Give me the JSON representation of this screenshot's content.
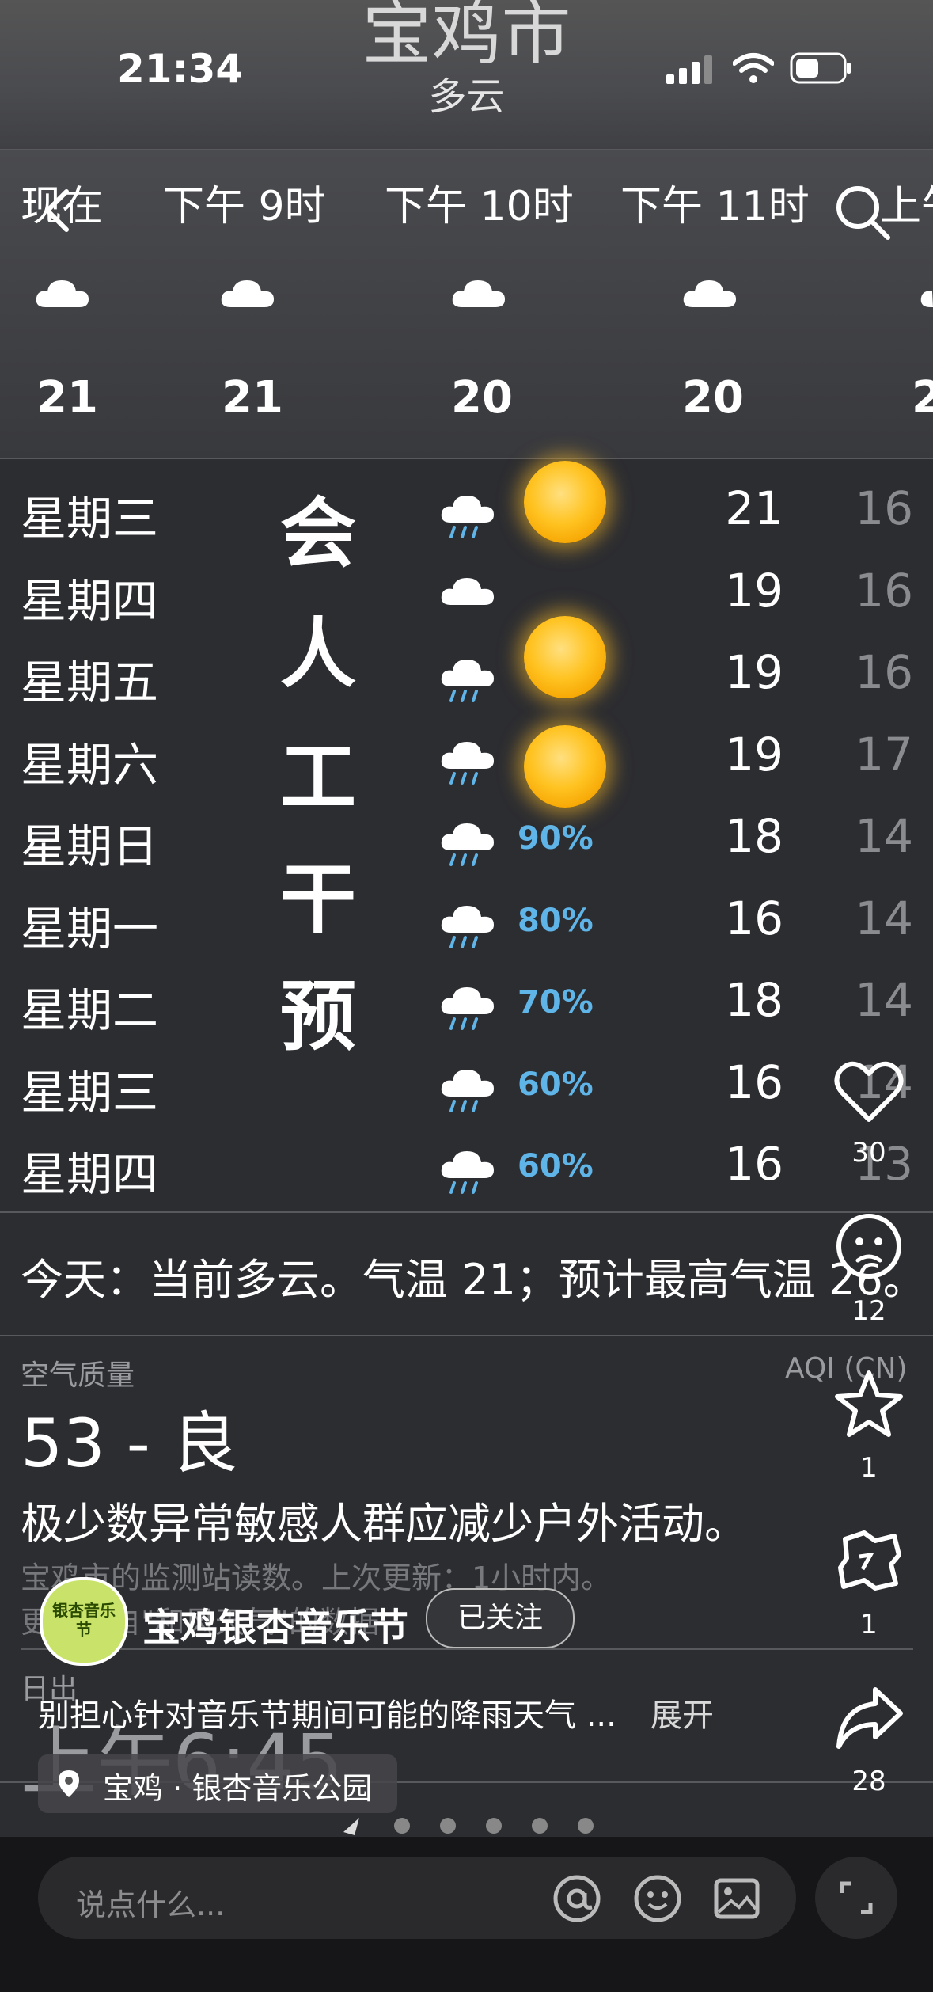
{
  "status_bar": {
    "time": "21:34"
  },
  "weather": {
    "city": "宝鸡市",
    "condition": "多云",
    "hourly": [
      {
        "label": "现在",
        "temp": "21"
      },
      {
        "label": "下午 9时",
        "temp": "21"
      },
      {
        "label": "下午 10时",
        "temp": "20"
      },
      {
        "label": "下午 11时",
        "temp": "20"
      },
      {
        "label": "上午",
        "temp": "2"
      }
    ],
    "daily": [
      {
        "day": "星期三",
        "pct": "",
        "hi": "21",
        "lo": "16"
      },
      {
        "day": "星期四",
        "pct": "",
        "hi": "19",
        "lo": "16"
      },
      {
        "day": "星期五",
        "pct": "",
        "hi": "19",
        "lo": "16"
      },
      {
        "day": "星期六",
        "pct": "",
        "hi": "19",
        "lo": "17"
      },
      {
        "day": "星期日",
        "pct": "90%",
        "hi": "18",
        "lo": "14"
      },
      {
        "day": "星期一",
        "pct": "80%",
        "hi": "16",
        "lo": "14"
      },
      {
        "day": "星期二",
        "pct": "70%",
        "hi": "18",
        "lo": "14"
      },
      {
        "day": "星期三",
        "pct": "60%",
        "hi": "16",
        "lo": "14"
      },
      {
        "day": "星期四",
        "pct": "60%",
        "hi": "16",
        "lo": "13"
      }
    ],
    "summary": "今天：当前多云。气温 21；预计最高气温 26。",
    "aqi": {
      "label": "空气质量",
      "scale": "AQI (CN)",
      "value": "53 - 良",
      "advice": "极少数异常敏感人群应减少户外活动。",
      "source_line1": "宝鸡市的监测站读数。上次更新：1小时内。",
      "source_line2": "更多来自\"和风天气\"的数据"
    },
    "sunrise_label": "日出",
    "sunrise_time": "上午6:45"
  },
  "overlay_text": [
    "会",
    "人",
    "工",
    "干",
    "预"
  ],
  "post": {
    "account": "宝鸡银杏音乐节",
    "follow_label": "已关注",
    "caption": "别担心针对音乐节期间可能的降雨天气 ...",
    "expand_label": "展开",
    "location": "宝鸡 · 银杏音乐公园",
    "avatar_text": "银杏音乐节"
  },
  "actions": {
    "likes": "30",
    "comments": "12",
    "favorites": "1",
    "shares_special": "1",
    "shares": "28"
  },
  "comment_input": {
    "placeholder": "说点什么..."
  },
  "colors": {
    "precip": "#5fb5e8",
    "sun": "#ffc321",
    "background": "#2c2d31"
  }
}
